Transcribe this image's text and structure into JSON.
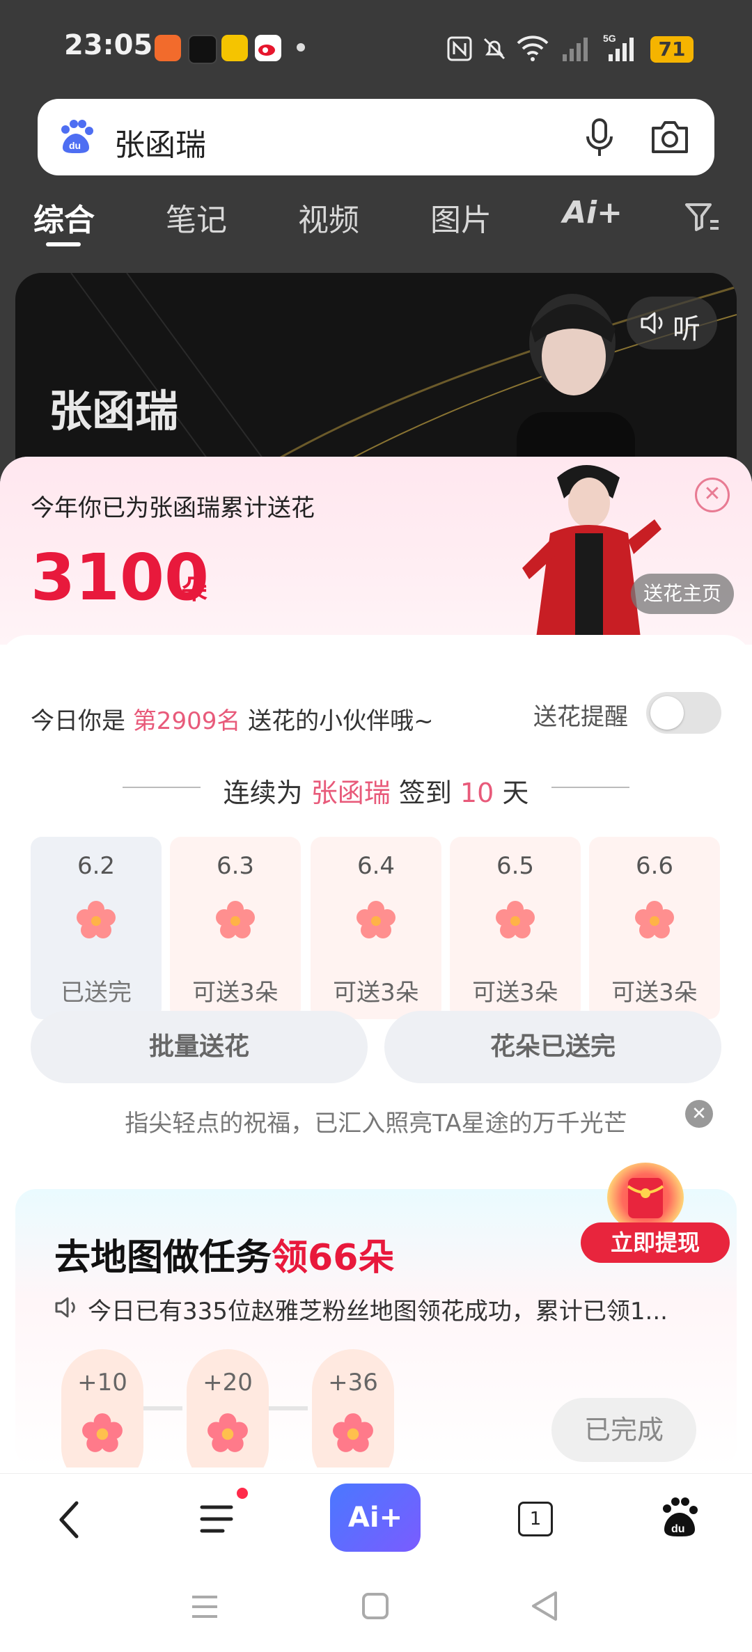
{
  "status_bar": {
    "time": "23:05",
    "battery": "71",
    "icons": [
      "nfc-icon",
      "mute-icon",
      "wifi-icon",
      "signal-icon",
      "5g-signal-icon"
    ]
  },
  "search": {
    "query": "张函瑞"
  },
  "tabs": [
    {
      "label": "综合",
      "active": true
    },
    {
      "label": "笔记"
    },
    {
      "label": "视频"
    },
    {
      "label": "图片"
    },
    {
      "label": "Ai+"
    }
  ],
  "hero": {
    "name": "张函瑞",
    "listen_label": "听"
  },
  "flower_panel": {
    "header_text": "今年你已为张函瑞累计送花",
    "count": "3100",
    "count_unit": "朵",
    "homepage_button": "送花主页",
    "rank_prefix": "今日你是",
    "rank": "第2909名",
    "rank_suffix": "送花的小伙伴哦~",
    "remind_label": "送花提醒",
    "streak_prefix": "连续为",
    "streak_name": "张函瑞",
    "streak_middle": "签到",
    "streak_days": "10",
    "streak_suffix": "天",
    "days": [
      {
        "date": "6.2",
        "label": "已送完",
        "done": true
      },
      {
        "date": "6.3",
        "label": "可送3朵"
      },
      {
        "date": "6.4",
        "label": "可送3朵"
      },
      {
        "date": "6.5",
        "label": "可送3朵"
      },
      {
        "date": "6.6",
        "label": "可送3朵"
      }
    ],
    "batch_button": "批量送花",
    "sent_button": "花朵已送完",
    "blessing": "指尖轻点的祝福，已汇入照亮TA星途的万千光芒"
  },
  "task": {
    "title": "去地图做任务",
    "title_accent": "领66朵",
    "note": "今日已有335位赵雅芝粉丝地图领花成功，累计已领1...",
    "steps": [
      "+10",
      "+20",
      "+36"
    ],
    "done_button": "已完成",
    "redeem_button": "立即提现"
  },
  "bottom_nav": {
    "ai_label": "Ai+",
    "tab_count": "1"
  }
}
